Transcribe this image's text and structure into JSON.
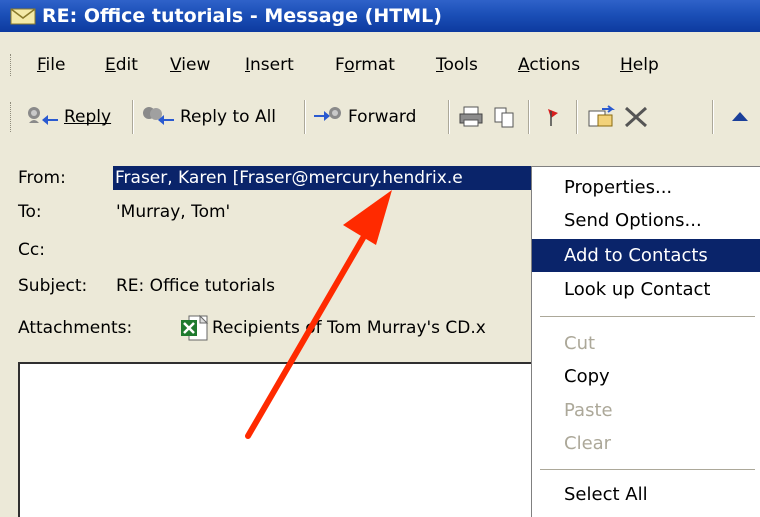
{
  "window": {
    "title": "RE: Office tutorials - Message (HTML)"
  },
  "menubar": {
    "items": [
      {
        "label": "File",
        "accel": "F"
      },
      {
        "label": "Edit",
        "accel": "E"
      },
      {
        "label": "View",
        "accel": "V"
      },
      {
        "label": "Insert",
        "accel": "I"
      },
      {
        "label": "Format",
        "accel": "o"
      },
      {
        "label": "Tools",
        "accel": "T"
      },
      {
        "label": "Actions",
        "accel": "A"
      },
      {
        "label": "Help",
        "accel": "H"
      }
    ]
  },
  "toolbar": {
    "reply_label": "Reply",
    "reply_all_label": "Reply to All",
    "forward_label": "Forward"
  },
  "header": {
    "from_label": "From:",
    "from_value": "Fraser, Karen [Fraser@mercury.hendrix.e",
    "to_label": "To:",
    "to_value": "'Murray, Tom'",
    "cc_label": "Cc:",
    "subject_label": "Subject:",
    "subject_value": "RE: Office tutorials",
    "attachments_label": "Attachments:",
    "attachment_name": "Recipients of Tom Murray's CD.x"
  },
  "context_menu": {
    "items": [
      {
        "label": "Properties...",
        "state": "normal"
      },
      {
        "label": "Send Options...",
        "state": "normal"
      },
      {
        "label": "Add to Contacts",
        "state": "selected"
      },
      {
        "label": "Look up Contact",
        "state": "normal"
      },
      {
        "label": "Cut",
        "state": "disabled"
      },
      {
        "label": "Copy",
        "state": "normal"
      },
      {
        "label": "Paste",
        "state": "disabled"
      },
      {
        "label": "Clear",
        "state": "disabled"
      },
      {
        "label": "Select All",
        "state": "normal"
      }
    ]
  },
  "colors": {
    "titlebar": "#1b4fb7",
    "selection": "#0a246a",
    "annotation_arrow": "#ff2a00"
  }
}
